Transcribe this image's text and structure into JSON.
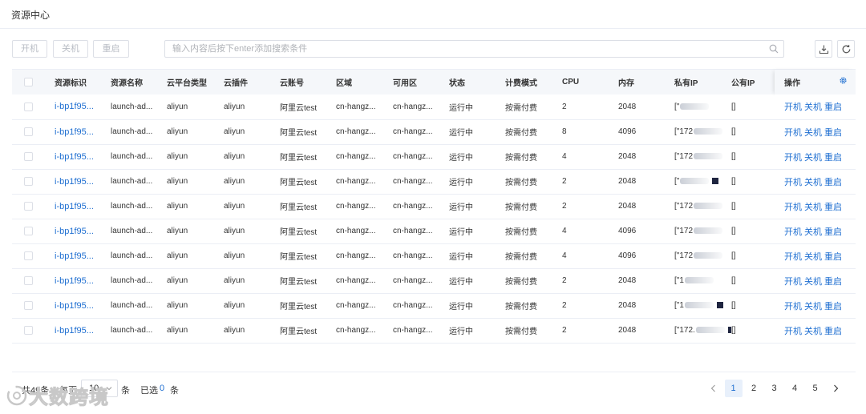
{
  "header": {
    "title": "资源中心"
  },
  "toolbar": {
    "power_on": "开机",
    "power_off": "关机",
    "restart": "重启",
    "search_placeholder": "输入内容后按下enter添加搜索条件"
  },
  "table": {
    "columns": [
      "资源标识",
      "资源名称",
      "云平台类型",
      "云插件",
      "云账号",
      "区域",
      "可用区",
      "状态",
      "计费模式",
      "CPU",
      "内存",
      "私有IP",
      "公有IP",
      "操作"
    ],
    "actions": [
      "开机",
      "关机",
      "重启"
    ],
    "rows": [
      {
        "id": "i-bp1f95...",
        "name": "launch-ad...",
        "platform": "aliyun",
        "plugin": "aliyun",
        "account": "阿里云test",
        "region": "cn-hangz...",
        "zone": "cn-hangz...",
        "status": "运行中",
        "billing": "按需付费",
        "cpu": "2",
        "memory": "2048",
        "private_ip": "[\"",
        "public_ip": "[]",
        "mark": ""
      },
      {
        "id": "i-bp1f95...",
        "name": "launch-ad...",
        "platform": "aliyun",
        "plugin": "aliyun",
        "account": "阿里云test",
        "region": "cn-hangz...",
        "zone": "cn-hangz...",
        "status": "运行中",
        "billing": "按需付费",
        "cpu": "8",
        "memory": "4096",
        "private_ip": "[\"172",
        "public_ip": "[]",
        "mark": ""
      },
      {
        "id": "i-bp1f95...",
        "name": "launch-ad...",
        "platform": "aliyun",
        "plugin": "aliyun",
        "account": "阿里云test",
        "region": "cn-hangz...",
        "zone": "cn-hangz...",
        "status": "运行中",
        "billing": "按需付费",
        "cpu": "4",
        "memory": "2048",
        "private_ip": "[\"172",
        "public_ip": "[]",
        "mark": ""
      },
      {
        "id": "i-bp1f95...",
        "name": "launch-ad...",
        "platform": "aliyun",
        "plugin": "aliyun",
        "account": "阿里云test",
        "region": "cn-hangz...",
        "zone": "cn-hangz...",
        "status": "运行中",
        "billing": "按需付费",
        "cpu": "2",
        "memory": "2048",
        "private_ip": "[\"",
        "public_ip": "[]",
        "mark": "dark"
      },
      {
        "id": "i-bp1f95...",
        "name": "launch-ad...",
        "platform": "aliyun",
        "plugin": "aliyun",
        "account": "阿里云test",
        "region": "cn-hangz...",
        "zone": "cn-hangz...",
        "status": "运行中",
        "billing": "按需付费",
        "cpu": "2",
        "memory": "2048",
        "private_ip": "[\"172",
        "public_ip": "[]",
        "mark": ""
      },
      {
        "id": "i-bp1f95...",
        "name": "launch-ad...",
        "platform": "aliyun",
        "plugin": "aliyun",
        "account": "阿里云test",
        "region": "cn-hangz...",
        "zone": "cn-hangz...",
        "status": "运行中",
        "billing": "按需付费",
        "cpu": "4",
        "memory": "4096",
        "private_ip": "[\"172",
        "public_ip": "[]",
        "mark": ""
      },
      {
        "id": "i-bp1f95...",
        "name": "launch-ad...",
        "platform": "aliyun",
        "plugin": "aliyun",
        "account": "阿里云test",
        "region": "cn-hangz...",
        "zone": "cn-hangz...",
        "status": "运行中",
        "billing": "按需付费",
        "cpu": "4",
        "memory": "4096",
        "private_ip": "[\"172",
        "public_ip": "[]",
        "mark": ""
      },
      {
        "id": "i-bp1f95...",
        "name": "launch-ad...",
        "platform": "aliyun",
        "plugin": "aliyun",
        "account": "阿里云test",
        "region": "cn-hangz...",
        "zone": "cn-hangz...",
        "status": "运行中",
        "billing": "按需付费",
        "cpu": "2",
        "memory": "2048",
        "private_ip": "[\"1",
        "public_ip": "[]",
        "mark": ""
      },
      {
        "id": "i-bp1f95...",
        "name": "launch-ad...",
        "platform": "aliyun",
        "plugin": "aliyun",
        "account": "阿里云test",
        "region": "cn-hangz...",
        "zone": "cn-hangz...",
        "status": "运行中",
        "billing": "按需付费",
        "cpu": "2",
        "memory": "2048",
        "private_ip": "[\"1",
        "public_ip": "[]",
        "mark": "dark"
      },
      {
        "id": "i-bp1f95...",
        "name": "launch-ad...",
        "platform": "aliyun",
        "plugin": "aliyun",
        "account": "阿里云test",
        "region": "cn-hangz...",
        "zone": "cn-hangz...",
        "status": "运行中",
        "billing": "按需付费",
        "cpu": "2",
        "memory": "2048",
        "private_ip": "[\"172.",
        "public_ip": "[]",
        "mark": "orange"
      }
    ]
  },
  "pagination": {
    "total_text": "共49条",
    "per_page_label": "每页",
    "page_size": "10",
    "unit": "条",
    "selected_label": "已选",
    "selected_count": "0",
    "selected_unit": "条",
    "pages": [
      "1",
      "2",
      "3",
      "4",
      "5"
    ],
    "current_page": "1"
  },
  "watermark": {
    "text": "大数跨境"
  },
  "colors": {
    "link": "#1f6fd1",
    "border": "#dcdfe6",
    "header_bg": "#f5f7fa",
    "active_page_bg": "#e8f0fb"
  }
}
